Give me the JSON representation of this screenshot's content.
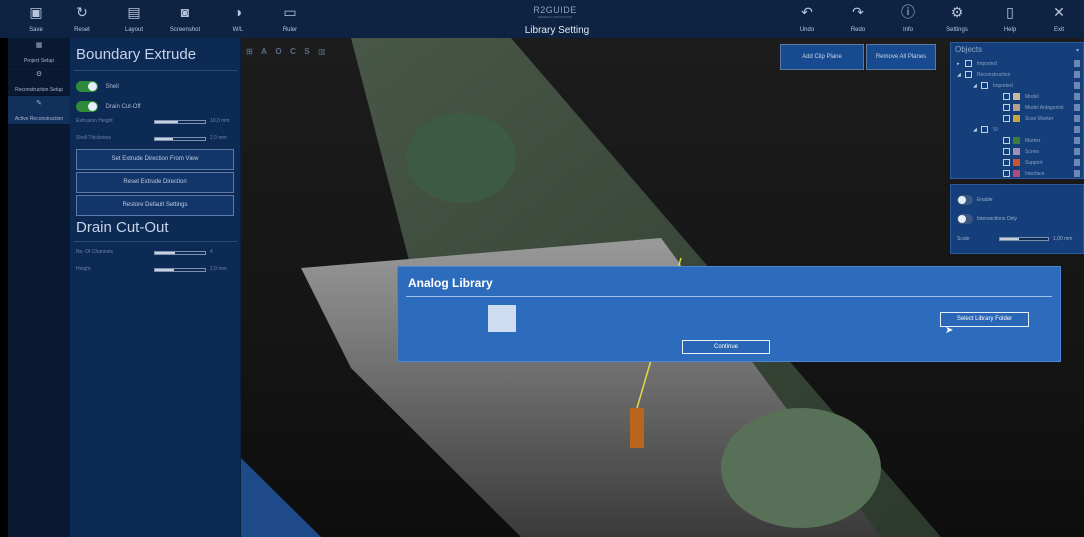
{
  "toolbar": {
    "title": "Library Setting",
    "brand": "R2GUIDE",
    "brand_sub": "GENERAL APPLICATION",
    "left_items": [
      {
        "label": "Save",
        "icon": "save-icon"
      },
      {
        "label": "Reset",
        "icon": "reset-icon"
      },
      {
        "label": "Layout",
        "icon": "layout-icon"
      },
      {
        "label": "Screenshot",
        "icon": "camera-icon"
      },
      {
        "label": "W/L",
        "icon": "contrast-icon"
      },
      {
        "label": "Ruler",
        "icon": "ruler-icon"
      }
    ],
    "right_items": [
      {
        "label": "Undo",
        "icon": "undo-icon"
      },
      {
        "label": "Redo",
        "icon": "redo-icon"
      },
      {
        "label": "Info",
        "icon": "info-icon"
      },
      {
        "label": "Settings",
        "icon": "gear-icon"
      },
      {
        "label": "Help",
        "icon": "book-icon"
      },
      {
        "label": "Exit",
        "icon": "close-icon"
      }
    ]
  },
  "steps": [
    {
      "label": "Project Setup",
      "active": false
    },
    {
      "label": "Reconstruction Setup",
      "active": false
    },
    {
      "label": "Active Reconstruction",
      "active": true
    }
  ],
  "panel": {
    "boundary_title": "Boundary Extrude",
    "shell_label": "Shell",
    "drain_cutoff_label": "Drain Cut-Off",
    "extrusion_height_label": "Extrusion Height",
    "extrusion_height_value": "10,0 mm",
    "extrusion_height_level": 0.45,
    "shell_thickness_label": "Shell Thickness",
    "shell_thickness_value": "2,0 mm",
    "shell_thickness_level": 0.35,
    "btn_set_direction": "Set Extrude Direction From View",
    "btn_reset_direction": "Reset Extrude Direction",
    "btn_restore": "Restore Default Settings",
    "drain_title": "Drain Cut-Out",
    "channels_label": "No. Of Channels",
    "channels_value": "4",
    "channels_level": 0.4,
    "height_label": "Height",
    "height_value": "2,0 mm",
    "height_level": 0.38
  },
  "viewport": {
    "view_icons": [
      "⊞",
      "A",
      "O",
      "C",
      "S",
      "▥"
    ],
    "add_clip_plane": "Add Clip Plane",
    "remove_all_planes": "Remove All Planes"
  },
  "objects": {
    "title": "Objects",
    "rows": [
      {
        "label": "Imported",
        "swatch": ""
      },
      {
        "label": "Reconstruction",
        "swatch": ""
      },
      {
        "label": "Imported",
        "swatch": ""
      },
      {
        "label": "Model",
        "swatch": "#c9b7a0"
      },
      {
        "label": "Model Antagonist",
        "swatch": "#b3a08c"
      },
      {
        "label": "Scan Marker",
        "swatch": "#c7a53c"
      },
      {
        "label": "SI",
        "swatch": ""
      },
      {
        "label": "Marker",
        "swatch": "#3d7d3a"
      },
      {
        "label": "Screw",
        "swatch": "#9e8fb3"
      },
      {
        "label": "Support",
        "swatch": "#d0522f"
      },
      {
        "label": "Interface",
        "swatch": "#b04a7a"
      }
    ]
  },
  "clip": {
    "enable_label": "Enable",
    "intersections_label": "Intersections Only",
    "scale_label": "Scale",
    "scale_value": "1,00 mm",
    "scale_level": 0.4
  },
  "dialog": {
    "title": "Analog Library",
    "select_folder": "Select Library Folder",
    "continue": "Continue"
  }
}
